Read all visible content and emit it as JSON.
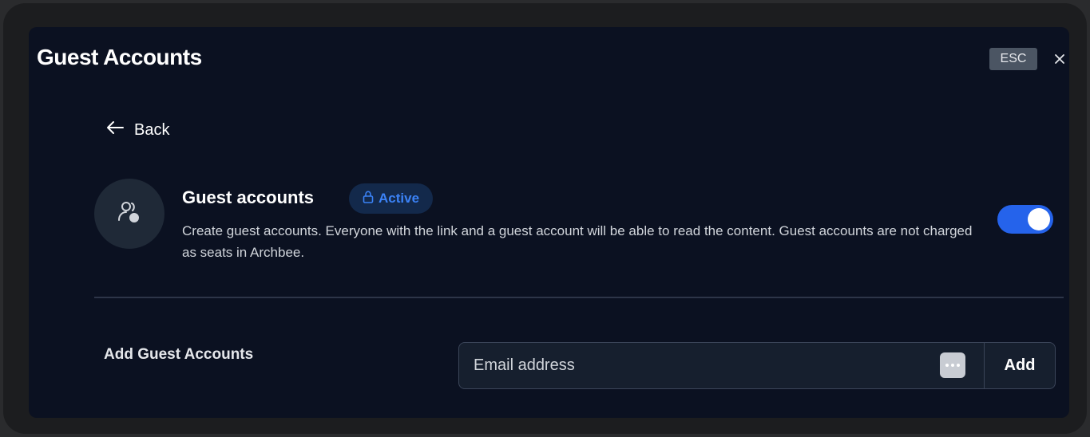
{
  "modal": {
    "title": "Guest Accounts",
    "esc_label": "ESC",
    "close_icon": "close-icon"
  },
  "navigation": {
    "back_label": "Back",
    "back_icon": "arrow-left-icon"
  },
  "feature": {
    "icon": "users-icon",
    "title": "Guest accounts",
    "status_label": "Active",
    "status_icon": "lock-icon",
    "description": "Create guest accounts. Everyone with the link and a guest account will be able to read the content. Guest accounts are not charged as seats in Archbee.",
    "enabled": true
  },
  "add_guest": {
    "label": "Add Guest Accounts",
    "email_placeholder": "Email address",
    "email_value": "",
    "autofill_icon": "more-dots-icon",
    "add_label": "Add"
  },
  "colors": {
    "accent": "#2563eb",
    "status_text": "#3b82f6",
    "background": "#0b1121"
  }
}
